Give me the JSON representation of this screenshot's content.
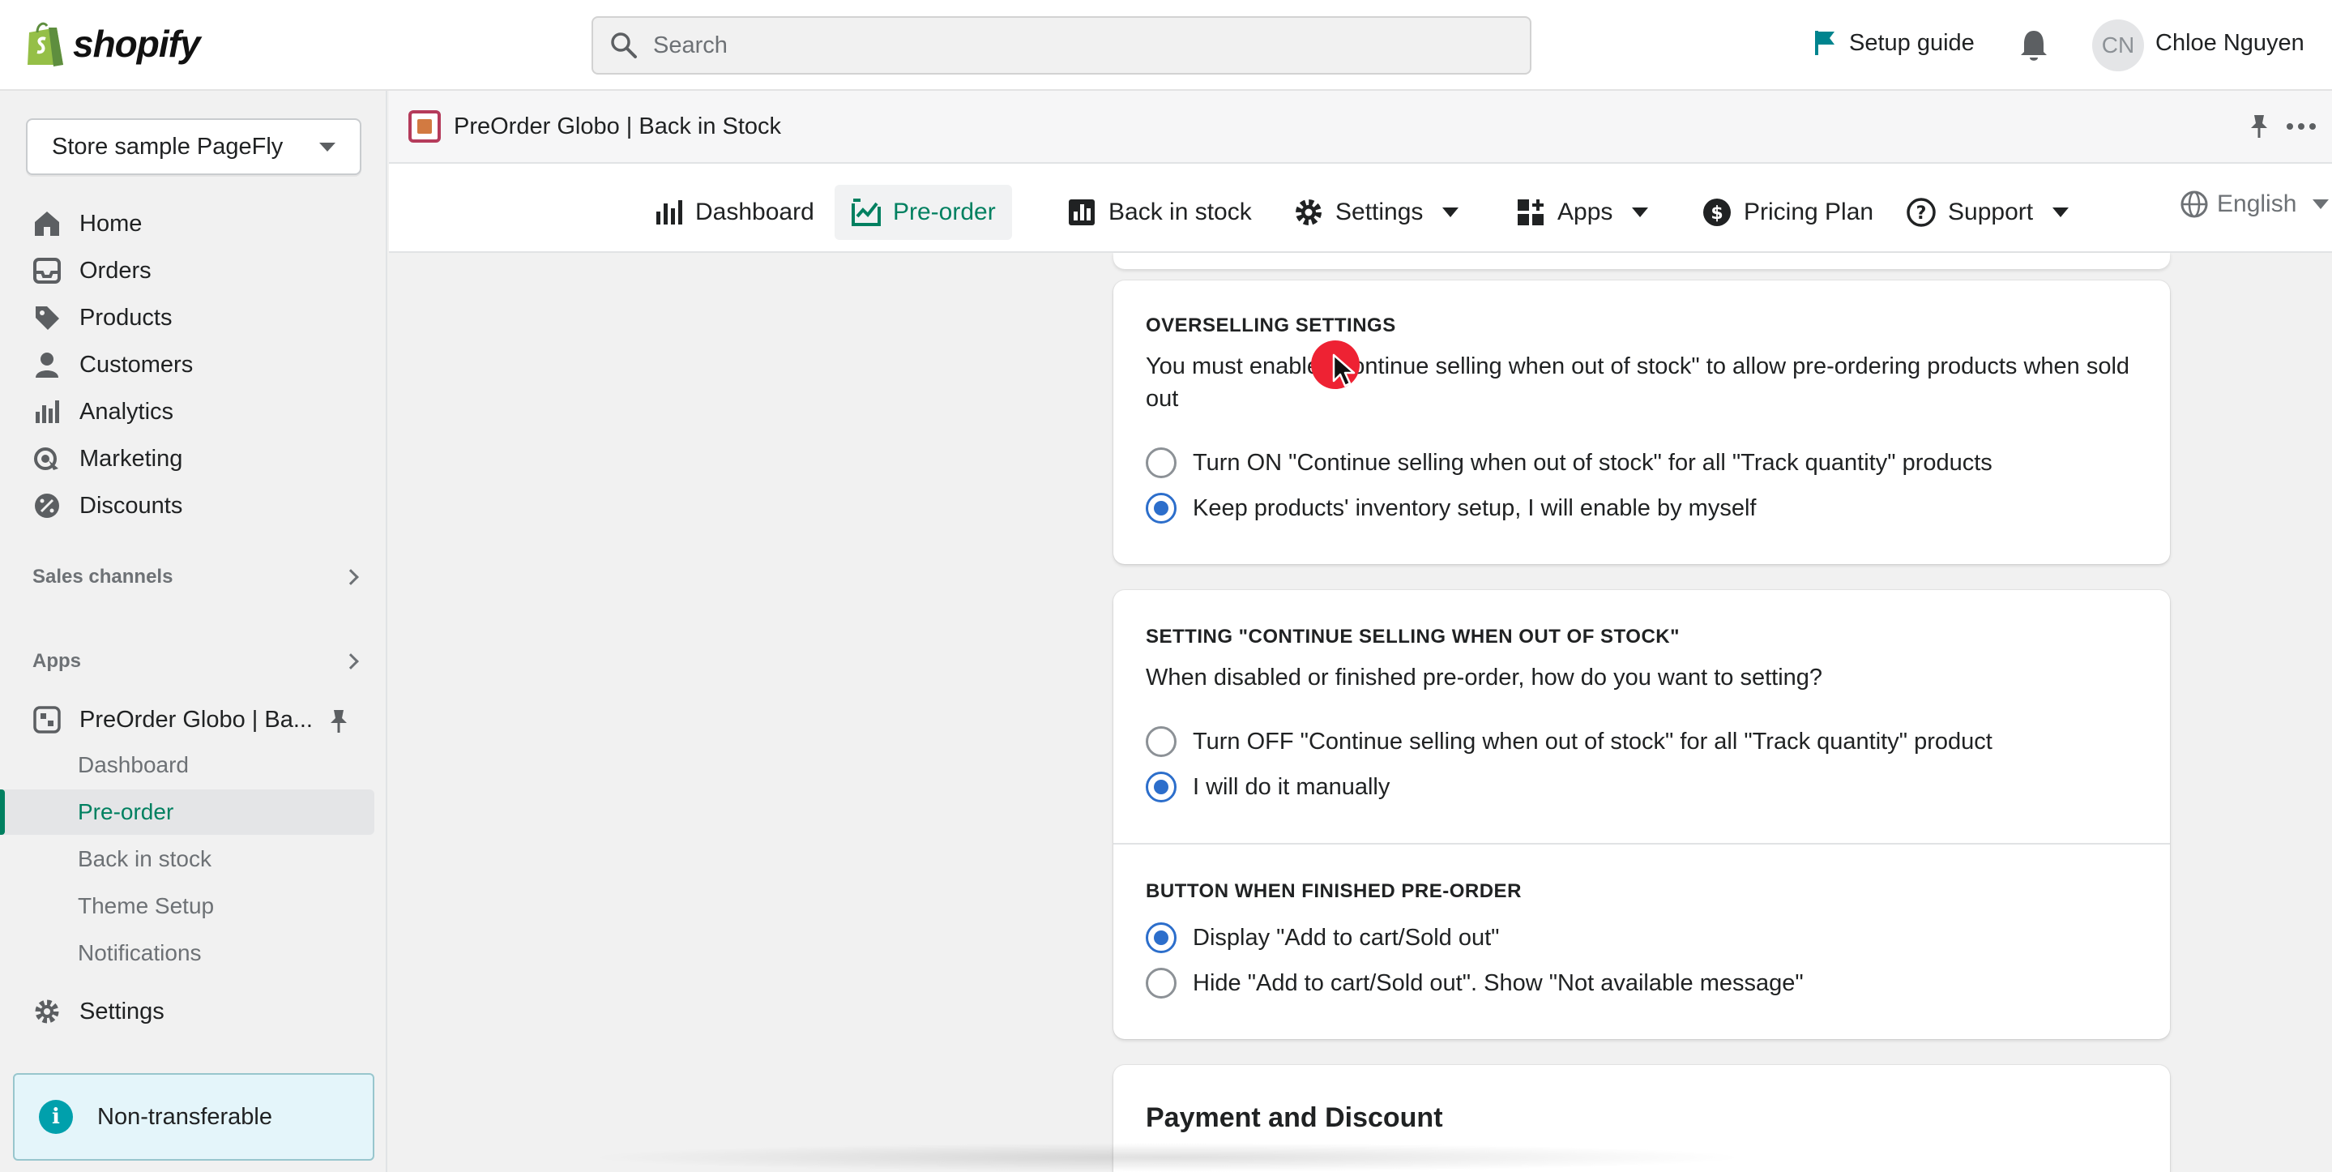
{
  "topbar": {
    "brand": "shopify",
    "search_placeholder": "Search",
    "setup_guide_label": "Setup guide",
    "user_initials": "CN",
    "user_name": "Chloe Nguyen"
  },
  "sidebar": {
    "store_name": "Store sample PageFly",
    "items": [
      {
        "label": "Home",
        "icon": "home-icon"
      },
      {
        "label": "Orders",
        "icon": "orders-icon"
      },
      {
        "label": "Products",
        "icon": "tag-icon"
      },
      {
        "label": "Customers",
        "icon": "person-icon"
      },
      {
        "label": "Analytics",
        "icon": "bar-chart-icon"
      },
      {
        "label": "Marketing",
        "icon": "target-icon"
      },
      {
        "label": "Discounts",
        "icon": "discount-icon"
      }
    ],
    "sales_channels_label": "Sales channels",
    "apps_label": "Apps",
    "app_name": "PreOrder Globo | Ba...",
    "app_subitems": [
      {
        "label": "Dashboard",
        "active": false
      },
      {
        "label": "Pre-order",
        "active": true
      },
      {
        "label": "Back in stock",
        "active": false
      },
      {
        "label": "Theme Setup",
        "active": false
      },
      {
        "label": "Notifications",
        "active": false
      }
    ],
    "settings_label": "Settings",
    "notice_label": "Non-transferable"
  },
  "app_header": {
    "title": "PreOrder Globo | Back in Stock"
  },
  "app_nav": {
    "items": [
      {
        "label": "Dashboard",
        "icon": "bar-chart-icon",
        "active": false,
        "dropdown": false
      },
      {
        "label": "Pre-order",
        "icon": "preorder-icon",
        "active": true,
        "dropdown": false
      },
      {
        "label": "Back in stock",
        "icon": "chart-box-icon",
        "active": false,
        "dropdown": false
      },
      {
        "label": "Settings",
        "icon": "gear-icon",
        "active": false,
        "dropdown": true
      },
      {
        "label": "Apps",
        "icon": "apps-icon",
        "active": false,
        "dropdown": true
      },
      {
        "label": "Pricing Plan",
        "icon": "dollar-icon",
        "active": false,
        "dropdown": false
      },
      {
        "label": "Support",
        "icon": "help-icon",
        "active": false,
        "dropdown": true
      }
    ],
    "language": "English"
  },
  "overselling": {
    "heading": "OVERSELLING SETTINGS",
    "description": "You must enable \"Continue selling when out of stock\" to allow pre-ordering products when sold out",
    "options": [
      {
        "label": "Turn ON \"Continue selling when out of stock\" for all \"Track quantity\" products",
        "checked": false
      },
      {
        "label": "Keep products' inventory setup, I will enable by myself",
        "checked": true
      }
    ]
  },
  "continue_selling": {
    "heading": "SETTING \"CONTINUE SELLING WHEN OUT OF STOCK\"",
    "description": "When disabled or finished pre-order, how do you want to setting?",
    "options": [
      {
        "label": "Turn OFF \"Continue selling when out of stock\" for all \"Track quantity\" product",
        "checked": false
      },
      {
        "label": "I will do it manually",
        "checked": true
      }
    ]
  },
  "button_finished": {
    "heading": "BUTTON WHEN FINISHED PRE-ORDER",
    "options": [
      {
        "label": "Display \"Add to cart/Sold out\"",
        "checked": true
      },
      {
        "label": "Hide \"Add to cart/Sold out\". Show \"Not available message\"",
        "checked": false
      }
    ]
  },
  "payment": {
    "title": "Payment and Discount"
  },
  "colors": {
    "accent_green": "#008060",
    "radio_blue": "#2c6ecb",
    "cursor_click": "#ee2233",
    "info_teal": "#00a0ac"
  }
}
